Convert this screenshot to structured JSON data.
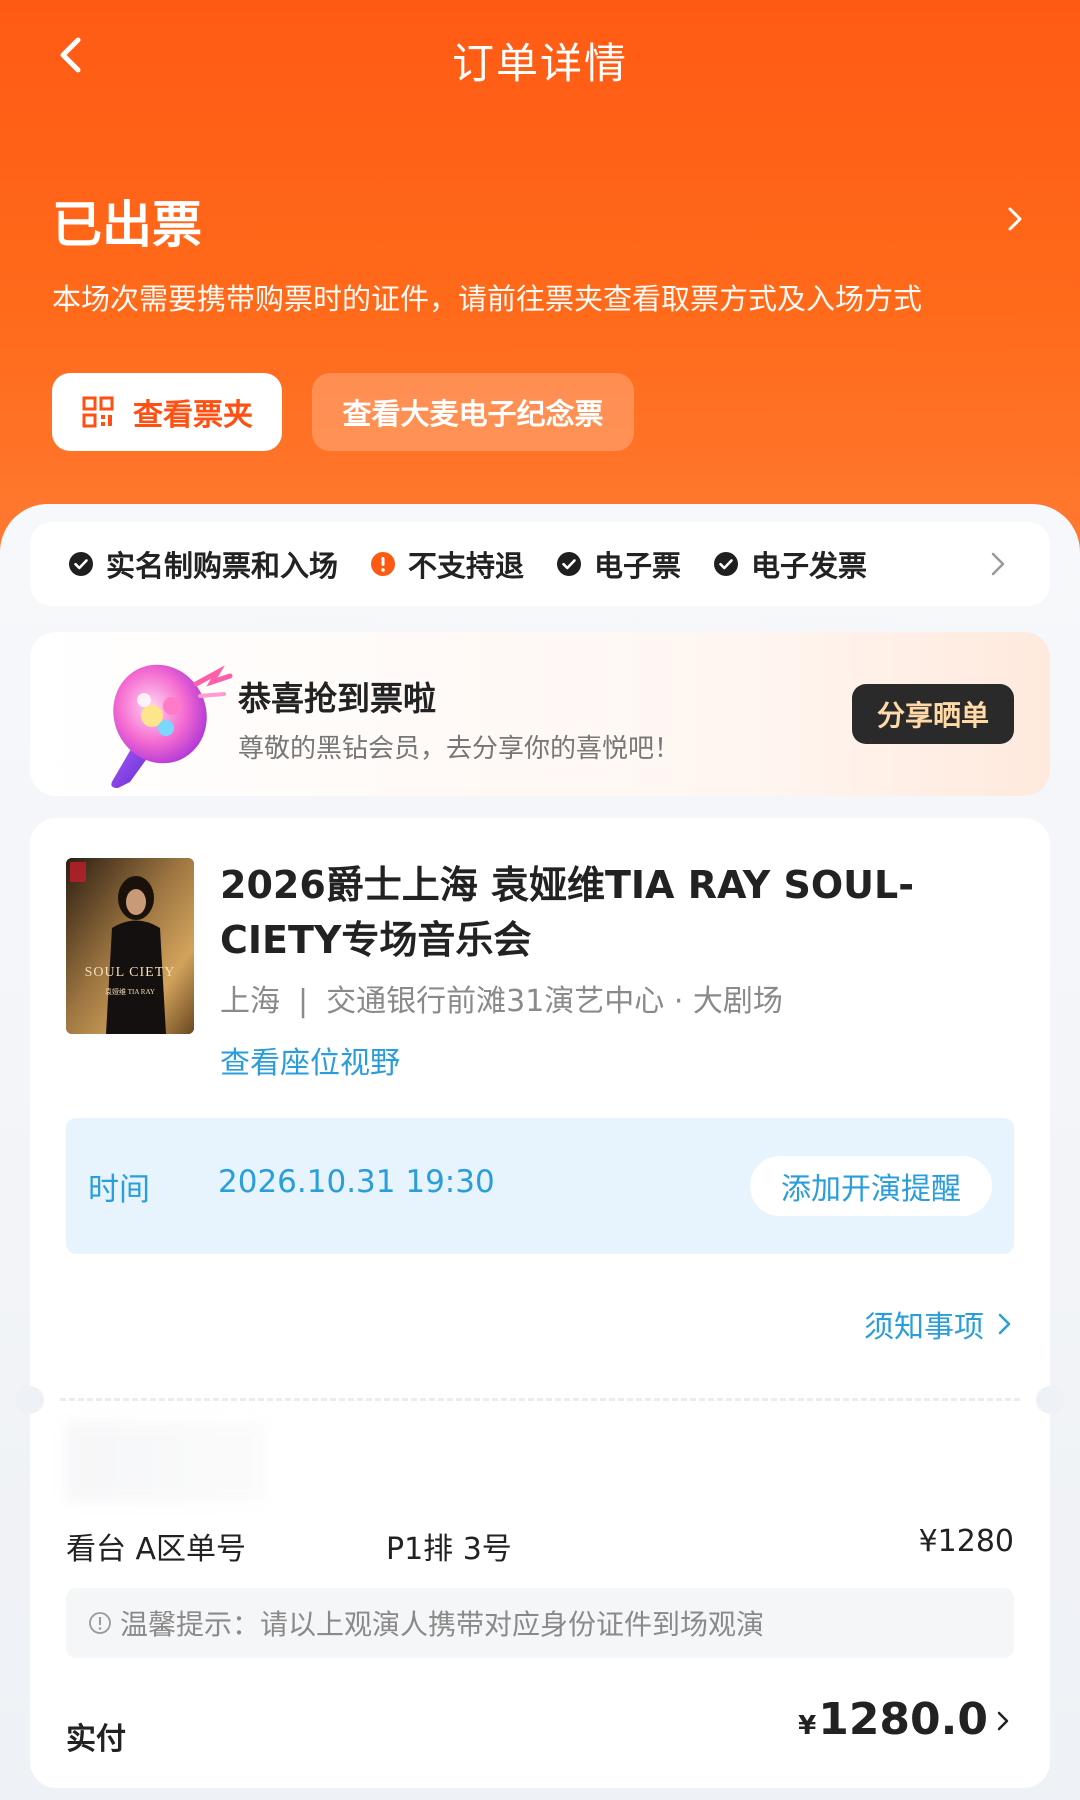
{
  "header": {
    "title": "订单详情"
  },
  "status": {
    "title": "已出票",
    "description": "本场次需要携带购票时的证件，请前往票夹查看取票方式及入场方式",
    "wallet_button": "查看票夹",
    "memorial_button": "查看大麦电子纪念票"
  },
  "policies": [
    {
      "label": "实名制购票和入场",
      "icon": "check-circle-icon"
    },
    {
      "label": "不支持退",
      "icon": "warning-circle-icon"
    },
    {
      "label": "电子票",
      "icon": "check-circle-icon"
    },
    {
      "label": "电子发票",
      "icon": "check-circle-icon"
    }
  ],
  "congrats": {
    "title": "恭喜抢到票啦",
    "subtitle": "尊敬的黑钻会员，去分享你的喜悦吧！",
    "share_button": "分享晒单"
  },
  "event": {
    "title": "2026爵士上海 袁娅维TIA RAY SOUL-CIETY专场音乐会",
    "city": "上海",
    "separator": "|",
    "venue": "交通银行前滩31演艺中心 · 大剧场",
    "seat_view_link": "查看座位视野",
    "poster_text": "SOUL CIETY",
    "poster_sub": "袁娅维 TIA RAY"
  },
  "time": {
    "label": "时间",
    "value": "2026.10.31 19:30",
    "remind_button": "添加开演提醒"
  },
  "notice_link": "须知事项",
  "ticket": {
    "zone": "看台 A区单号",
    "seat": "P1排 3号",
    "price": "¥1280"
  },
  "tip": "温馨提示：请以上观演人携带对应身份证件到场观演",
  "payment": {
    "label": "实付",
    "currency": "¥",
    "amount": "1280.0"
  },
  "colors": {
    "brand_orange": "#ff5a14",
    "link_blue": "#2a9ddb",
    "warning": "#ff5a14"
  }
}
